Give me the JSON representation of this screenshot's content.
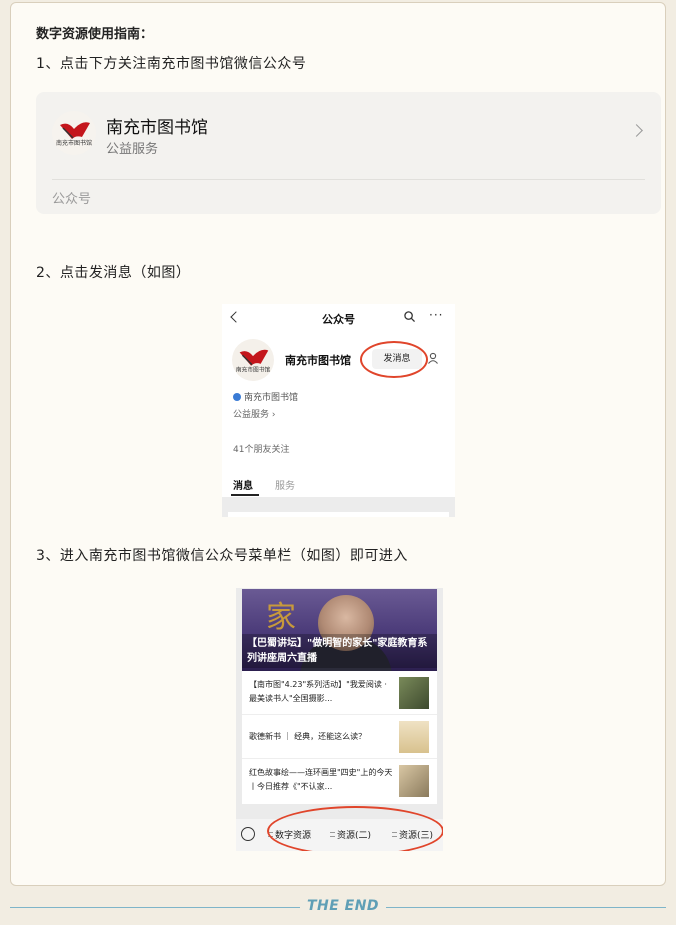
{
  "guide": {
    "title": "数字资源使用指南：",
    "step1": "1、点击下方关注南充市图书馆微信公众号",
    "step2": "2、点击发消息（如图）",
    "step3": "3、进入南充市图书馆微信公众号菜单栏（如图）即可进入"
  },
  "account_card": {
    "name": "南充市图书馆",
    "subtitle": "公益服务",
    "type_label": "公众号",
    "logo_text": "南充市图书馆"
  },
  "screenshot1": {
    "title": "公众号",
    "more": "···",
    "name": "南充市图书馆",
    "send_button": "发消息",
    "verified_name": "南充市图书馆",
    "service": "公益服务 ›",
    "friends": "41个朋友关注",
    "tab_messages": "消息",
    "tab_services": "服务",
    "logo_text": "南充市图书馆"
  },
  "screenshot2": {
    "banner_glyph": "家",
    "banner_caption": "【巴蜀讲坛】\"做明智的家长\"家庭教育系列讲座周六直播",
    "articles": [
      {
        "text": "【南市图\"4.23\"系列活动】\"我爱阅读 · 最美读书人\"全国摄影..."
      },
      {
        "text": "歌德新书 ｜ 经典，还能这么读？"
      },
      {
        "text": "红色故事绘——连环画里\"四史\"上的今天丨今日推荐《\"不认家..."
      }
    ],
    "menu": [
      "数字资源",
      "资源(二)",
      "资源(三)"
    ]
  },
  "footer": {
    "end_text": "THE END"
  },
  "colors": {
    "accent_ring": "#e0452b",
    "end_text": "#5f9fb6",
    "card_bg": "#fdfbf5"
  }
}
